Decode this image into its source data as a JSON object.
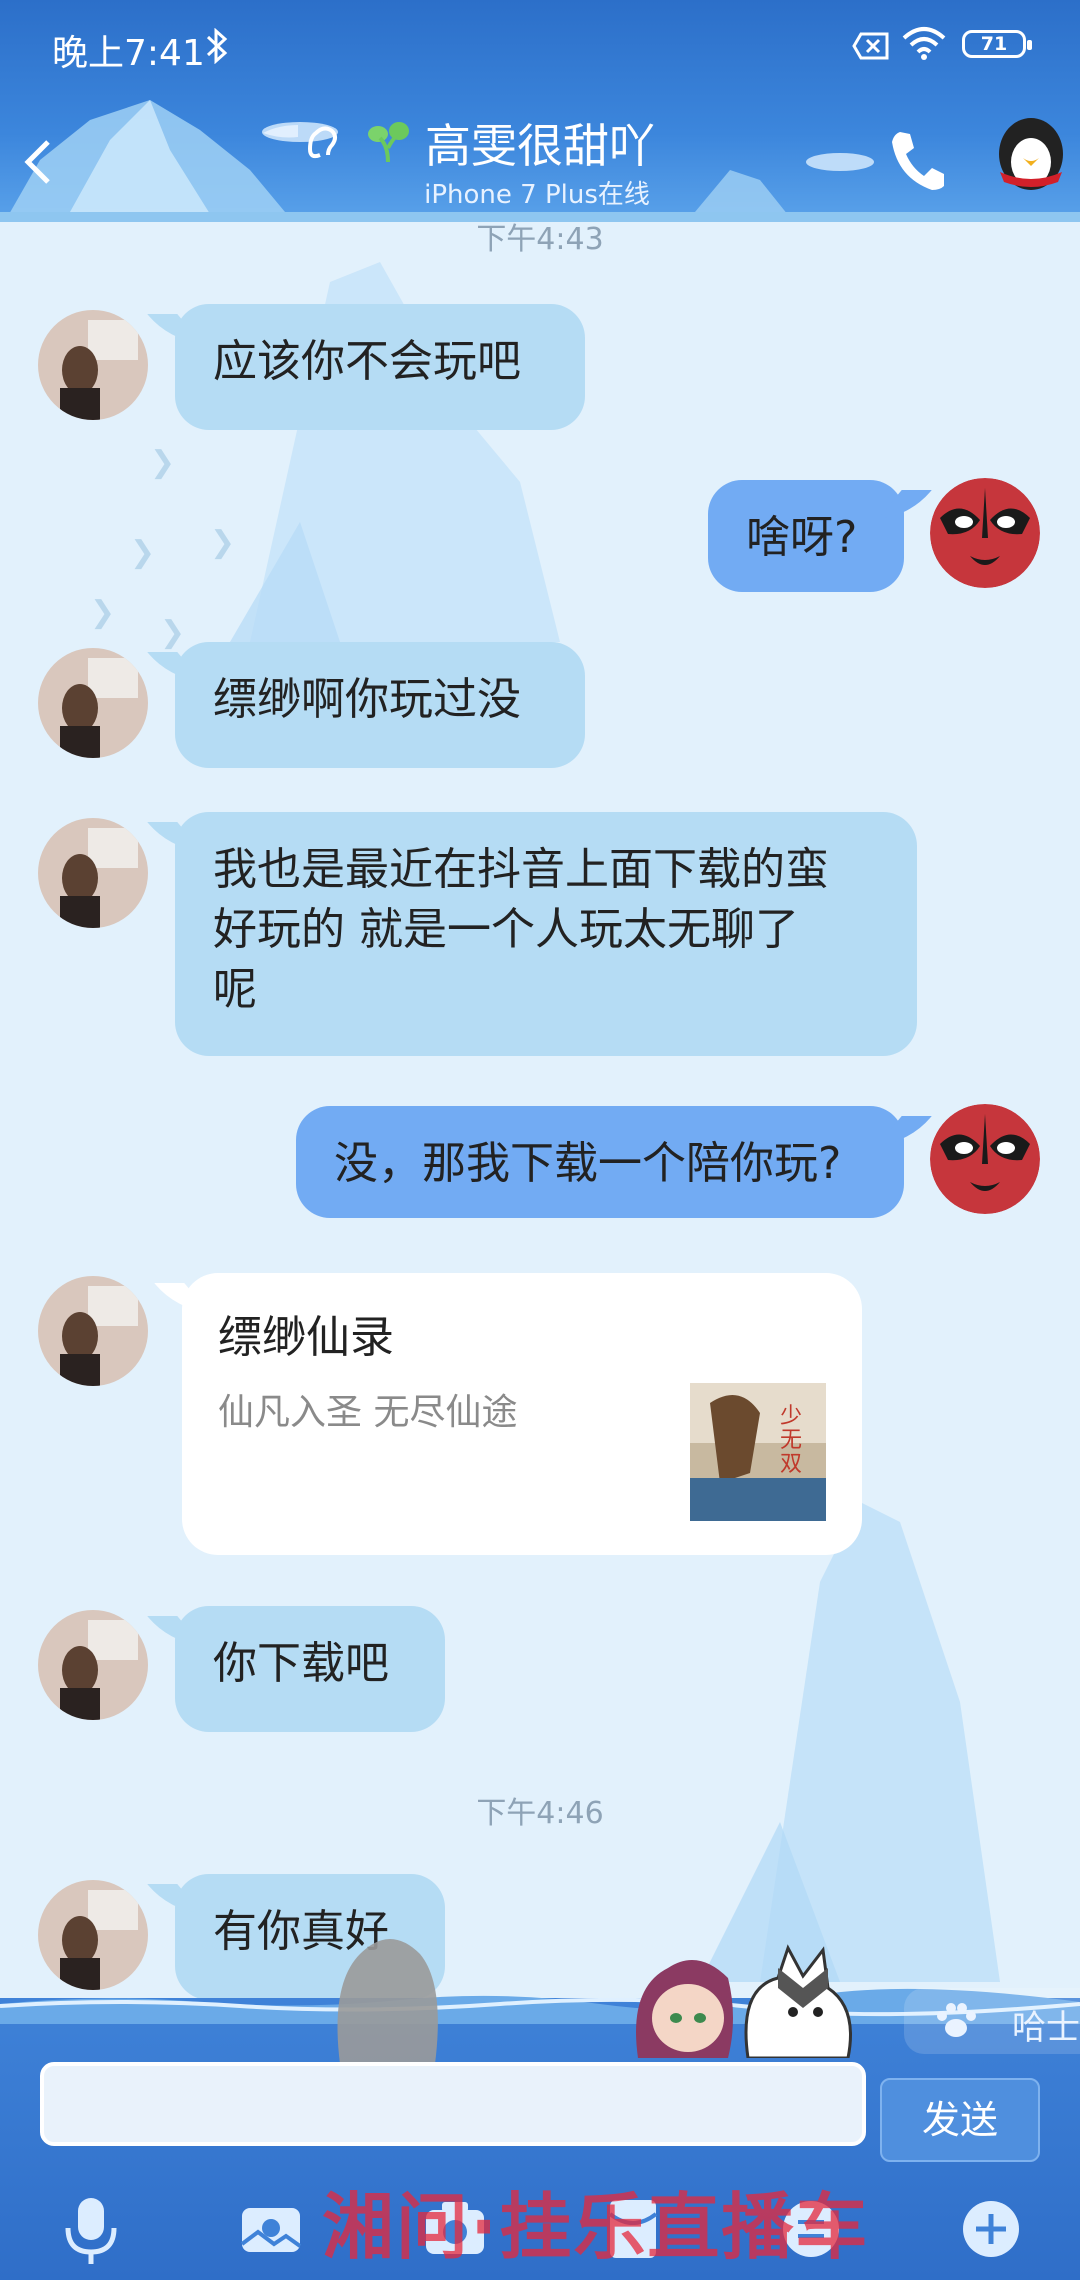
{
  "status_bar": {
    "time": "晚上7:41",
    "battery": "71",
    "icons": [
      "bluetooth-icon",
      "sim-card-icon",
      "wifi-icon",
      "battery-icon"
    ]
  },
  "header": {
    "contact_name": "高雯很甜吖",
    "contact_status": "iPhone 7 Plus在线",
    "icons": [
      "back-icon",
      "ear-icon",
      "sprout-icon",
      "phone-icon",
      "penguin-icon"
    ]
  },
  "messages": {
    "time_top": "下午4:43",
    "m1": "应该你不会玩吧",
    "m2": "啥呀?",
    "m3": "缥缈啊你玩过没",
    "m4_line1": "我也是最近在抖音上面下载的蛮",
    "m4_line2": "好玩的 就是一个人玩太无聊了",
    "m4_line3": "呢",
    "m5": "没，那我下载一个陪你玩?",
    "card_title": "缥缈仙录",
    "card_desc": "仙凡入圣 无尽仙途",
    "m6": "你下载吧",
    "time_mid": "下午4:46",
    "m7": "有你真好"
  },
  "input": {
    "placeholder": "",
    "send_label": "发送",
    "husky_chip_label": "哈士",
    "watermark": "湘问·挂乐直播车"
  },
  "toolbar": [
    "microphone-icon",
    "image-icon",
    "camera-icon",
    "red-envelope-icon",
    "emoji-icon",
    "plus-icon"
  ],
  "colors": {
    "header_blue": "#3c86dc",
    "bubble_in": "#b5dcf4",
    "bubble_out": "#72abf3",
    "chat_bg": "#e2f1fc"
  }
}
